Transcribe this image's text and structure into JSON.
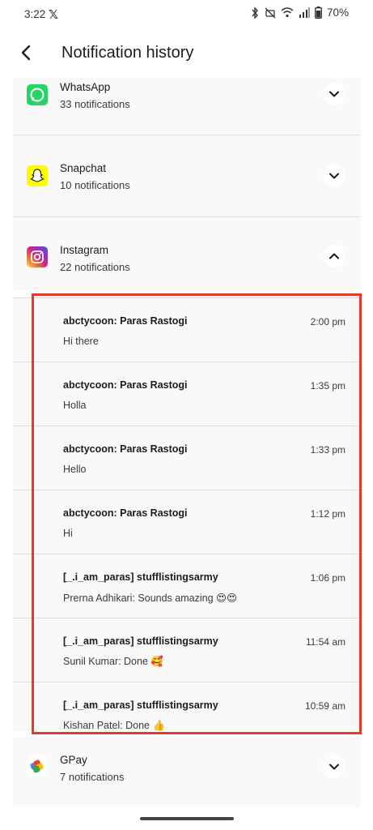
{
  "status": {
    "time": "3:22",
    "battery": "70%"
  },
  "header": {
    "title": "Notification history"
  },
  "apps": [
    {
      "name": "WhatsApp",
      "count": "33 notifications",
      "expanded": false
    },
    {
      "name": "Snapchat",
      "count": "10 notifications",
      "expanded": false
    },
    {
      "name": "Instagram",
      "count": "22 notifications",
      "expanded": true
    },
    {
      "name": "GPay",
      "count": "7 notifications",
      "expanded": false
    }
  ],
  "instagram_notifications": [
    {
      "title": "abctycoon: Paras Rastogi",
      "time": "2:00 pm",
      "text": "Hi there"
    },
    {
      "title": "abctycoon: Paras Rastogi",
      "time": "1:35 pm",
      "text": "Holla"
    },
    {
      "title": "abctycoon: Paras Rastogi",
      "time": "1:33 pm",
      "text": "Hello"
    },
    {
      "title": "abctycoon: Paras Rastogi",
      "time": "1:12 pm",
      "text": "Hi"
    },
    {
      "title": "[_.i_am_paras] stufflistingsarmy",
      "time": "1:06 pm",
      "text": "Prerna Adhikari: Sounds amazing 😍😍"
    },
    {
      "title": "[_.i_am_paras] stufflistingsarmy",
      "time": "11:54 am",
      "text": "Sunil Kumar: Done 🥰"
    },
    {
      "title": "[_.i_am_paras] stufflistingsarmy",
      "time": "10:59 am",
      "text": "Kishan Patel: Done 👍"
    }
  ],
  "colors": {
    "highlight": "#e8382c",
    "card_bg": "#fbf8f8",
    "whatsapp": "#25d366",
    "snapchat": "#fffc00"
  }
}
